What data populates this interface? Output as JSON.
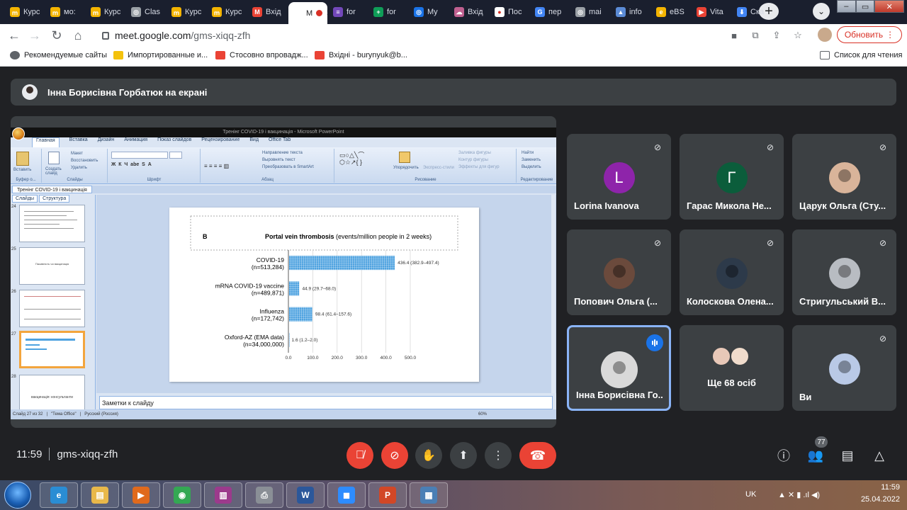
{
  "browser": {
    "tabs": [
      {
        "label": "Курс",
        "icon_color": "#f4b400",
        "glyph": "ՠ"
      },
      {
        "label": "мо:",
        "icon_color": "#f4b400",
        "glyph": "ՠ"
      },
      {
        "label": "Курс",
        "icon_color": "#f4b400",
        "glyph": "ՠ"
      },
      {
        "label": "Clas",
        "icon_color": "#9aa0a6",
        "glyph": "◎"
      },
      {
        "label": "Курс",
        "icon_color": "#f4b400",
        "glyph": "ՠ"
      },
      {
        "label": "Курс",
        "icon_color": "#f4b400",
        "glyph": "ՠ"
      },
      {
        "label": "Вхід",
        "icon_color": "#ea4335",
        "glyph": "M"
      },
      {
        "label": "M",
        "icon_color": "#ffffff",
        "glyph": ""
      },
      {
        "label": "for",
        "icon_color": "#7248b9",
        "glyph": "≡"
      },
      {
        "label": "for",
        "icon_color": "#0f9d58",
        "glyph": "+"
      },
      {
        "label": "My",
        "icon_color": "#1a73e8",
        "glyph": "◎"
      },
      {
        "label": "Вхід",
        "icon_color": "#c06090",
        "glyph": "☁"
      },
      {
        "label": "Пос",
        "icon_color": "#ffffff",
        "glyph": "●"
      },
      {
        "label": "пер",
        "icon_color": "#4285f4",
        "glyph": "G"
      },
      {
        "label": "mai",
        "icon_color": "#9aa0a6",
        "glyph": "◎"
      },
      {
        "label": "info",
        "icon_color": "#5b8bd6",
        "glyph": "▲"
      },
      {
        "label": "eBS",
        "icon_color": "#f4b400",
        "glyph": "e"
      },
      {
        "label": "Vita",
        "icon_color": "#ea4335",
        "glyph": "▶"
      },
      {
        "label": "Ска",
        "icon_color": "#4285f4",
        "glyph": "⬇"
      }
    ],
    "new_tab_glyph": "+",
    "tab_menu_glyph": "⌄",
    "url_host": "meet.google.com",
    "url_path": "/gms-xiqq-zfh",
    "update_label": "Обновить",
    "bookmarks": [
      {
        "label": "Рекомендуемые сайты",
        "icon_color": "#5f6368"
      },
      {
        "label": "Импортированные и...",
        "icon_color": "#f4c20d"
      },
      {
        "label": "Стосовно впровадж...",
        "icon_color": "#ea4335"
      },
      {
        "label": "Вхідні - burynyuk@b...",
        "icon_color": "#ea4335"
      }
    ],
    "reading_list_label": "Список для чтения"
  },
  "meet": {
    "presenter_banner": "Інна Борисівна Горбатюк на екрані",
    "meeting_time": "11:59",
    "meeting_code": "gms-xiqq-zfh",
    "people_count": "77",
    "participants": [
      {
        "name": "Lorina Ivanova",
        "initial": "L",
        "color": "#8e24aa",
        "active": false
      },
      {
        "name": "Гарас Микола Не...",
        "initial": "Г",
        "color": "#0b5d3b",
        "active": false
      },
      {
        "name": "Царук Ольга (Сту...",
        "initial": "",
        "color": "#d9b49a",
        "active": false
      },
      {
        "name": "Попович Ольга (...",
        "initial": "",
        "color": "#6b4a3c",
        "active": false
      },
      {
        "name": "Колоскова Олена...",
        "initial": "",
        "color": "#2d3a4a",
        "active": false
      },
      {
        "name": "Стригульський В...",
        "initial": "",
        "color": "#b8bcc2",
        "active": false
      },
      {
        "name": "Інна Борисівна Го...",
        "initial": "",
        "color": "#d9d9d9",
        "active": true
      },
      {
        "name": "Ще 68 осіб",
        "initial": "",
        "color": "#e8c8b8",
        "active": false
      },
      {
        "name": "Ви",
        "initial": "",
        "color": "#b9c9e6",
        "active": false
      }
    ]
  },
  "powerpoint": {
    "window_title": "Тренінг COVID-19 і вакцинація - Microsoft PowerPoint",
    "menu_tabs": [
      "Главная",
      "Вставка",
      "Дизайн",
      "Анимация",
      "Показ слайдов",
      "Рецензирование",
      "Вид",
      "Office Tab"
    ],
    "ribbon_groups": [
      "Буфер о...",
      "Слайды",
      "Шрифт",
      "Абзац",
      "Рисование",
      "Редактирование"
    ],
    "ribbon_items": {
      "paste": "Вставить",
      "create_slide": "Создать слайд",
      "layout": "Макет",
      "restore": "Восстановить",
      "delete": "Удалить",
      "text_direction": "Направление текста",
      "align_text": "Выровнять текст",
      "smartart": "Преобразовать в SmartArt",
      "arrange": "Упорядочить",
      "quick_styles": "Экспресс-стили",
      "fill": "Заливка фигуры",
      "outline": "Контур фигуры",
      "effects": "Эффекты для фигур",
      "find": "Найти",
      "replace": "Заменить",
      "select": "Выделить"
    },
    "doc_tab": "Тренінг COVID-19 і вакцинація",
    "pane_tabs": [
      "Слайды",
      "Структура"
    ],
    "slide_numbers": [
      "24",
      "25",
      "26",
      "27",
      "28"
    ],
    "thumb_texts": {
      "slide25": "Пасивність чи вакцинація",
      "slide28": "вакцинація: консультанти"
    },
    "notes_placeholder": "Заметки к слайду",
    "status": {
      "slide": "Слайд 27 из 32",
      "theme": "\"Тема Office\"",
      "lang": "Русский (Россия)",
      "zoom": "60%"
    }
  },
  "chart_data": {
    "type": "bar",
    "panel_label": "B",
    "title_bold": "Portal vein thrombosis",
    "title_rest": " (events/million people in 2 weeks)",
    "categories": [
      {
        "name": "COVID-19",
        "n": "(n=513,284)"
      },
      {
        "name": "mRNA COVID-19 vaccine",
        "n": "(n=489,871)"
      },
      {
        "name": "Influenza",
        "n": "(n=172,742)"
      },
      {
        "name": "Oxford-AZ (EMA data)",
        "n": "(n=34,000,000)"
      }
    ],
    "values": [
      436.4,
      44.9,
      98.4,
      1.6
    ],
    "labels": [
      "436.4 (382.9–497.4)",
      "44.9 (29.7–68.0)",
      "98.4 (61.4–157.6)",
      "1.6 (1.2–2.0)"
    ],
    "xlim": [
      0,
      500
    ],
    "xticks": [
      "0.0",
      "100.0",
      "200.0",
      "300.0",
      "400.0",
      "500.0"
    ],
    "bar_color": "#4fa3e0",
    "grid": true
  },
  "taskbar": {
    "lang": "UK",
    "clock_time": "11:59",
    "clock_date": "25.04.2022",
    "apps": [
      {
        "name": "ie",
        "color": "#2a8dd4",
        "glyph": "e"
      },
      {
        "name": "explorer",
        "color": "#e8b84a",
        "glyph": "▤"
      },
      {
        "name": "media",
        "color": "#e06a1c",
        "glyph": "▶"
      },
      {
        "name": "chrome",
        "color": "#34a853",
        "glyph": "◉"
      },
      {
        "name": "winrar",
        "color": "#9c3a8c",
        "glyph": "▥"
      },
      {
        "name": "printer",
        "color": "#8a8f96",
        "glyph": "⎙"
      },
      {
        "name": "word",
        "color": "#2b579a",
        "glyph": "W"
      },
      {
        "name": "zoom",
        "color": "#2d8cff",
        "glyph": "◼"
      },
      {
        "name": "powerpoint",
        "color": "#d24726",
        "glyph": "P"
      },
      {
        "name": "screen",
        "color": "#4a7fb5",
        "glyph": "▦"
      }
    ]
  }
}
